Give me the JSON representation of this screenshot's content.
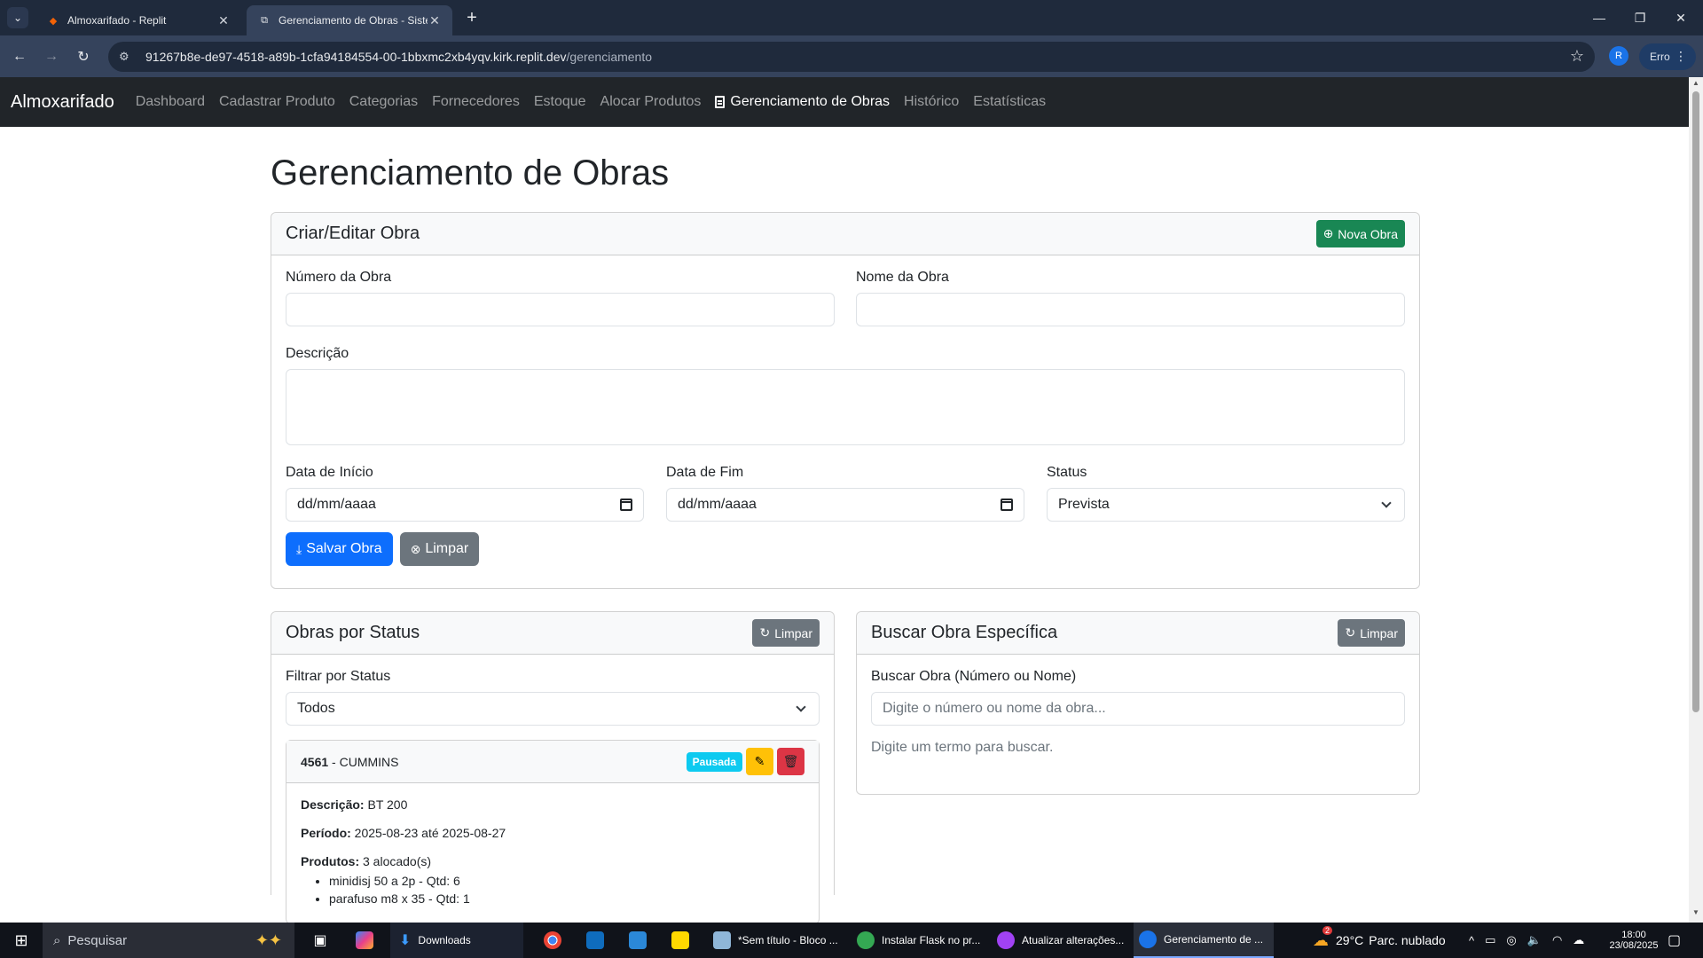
{
  "browser": {
    "tabs": [
      {
        "title": "Almoxarifado - Replit",
        "active": false
      },
      {
        "title": "Gerenciamento de Obras - Siste",
        "active": true
      }
    ],
    "url_host": "91267b8e-de97-4518-a89b-1cfa94184554-00-1bbxmc2xb4yqv.kirk.replit.dev",
    "url_path": "/gerenciamento",
    "profile_initial": "R",
    "error_label": "Erro"
  },
  "navbar": {
    "brand": "Almoxarifado",
    "links": [
      "Dashboard",
      "Cadastrar Produto",
      "Categorias",
      "Fornecedores",
      "Estoque",
      "Alocar Produtos",
      "Gerenciamento de Obras",
      "Histórico",
      "Estatísticas"
    ]
  },
  "page": {
    "title": "Gerenciamento de Obras"
  },
  "form_card": {
    "header": "Criar/Editar Obra",
    "new_button": "Nova Obra",
    "numero_label": "Número da Obra",
    "numero_value": "",
    "nome_label": "Nome da Obra",
    "nome_value": "",
    "descricao_label": "Descrição",
    "descricao_value": "",
    "data_inicio_label": "Data de Início",
    "data_inicio_value": "dd/mm/aaaa",
    "data_fim_label": "Data de Fim",
    "data_fim_value": "dd/mm/aaaa",
    "status_label": "Status",
    "status_value": "Prevista",
    "save_button": "Salvar Obra",
    "clear_button": "Limpar"
  },
  "status_card": {
    "header": "Obras por Status",
    "clear_button": "Limpar",
    "filter_label": "Filtrar por Status",
    "filter_value": "Todos",
    "obras": [
      {
        "numero": "4561",
        "separator": " - ",
        "nome": "CUMMINS",
        "status": "Pausada",
        "descricao_label": "Descrição:",
        "descricao": "BT 200",
        "periodo_label": "Período:",
        "periodo": "2025-08-23 até 2025-08-27",
        "produtos_label": "Produtos:",
        "produtos_count": "3 alocado(s)",
        "produtos": [
          "minidisj 50 a 2p - Qtd: 6",
          "parafuso m8 x 35 - Qtd: 1"
        ]
      }
    ]
  },
  "search_card": {
    "header": "Buscar Obra Específica",
    "clear_button": "Limpar",
    "search_label": "Buscar Obra (Número ou Nome)",
    "search_placeholder": "Digite o número ou nome da obra...",
    "hint": "Digite um termo para buscar."
  },
  "taskbar": {
    "search_placeholder": "Pesquisar",
    "items": [
      "Downloads",
      "*Sem título - Bloco ...",
      "Instalar Flask no pr...",
      "Atualizar alterações...",
      "Gerenciamento de ..."
    ],
    "weather": "29°C",
    "weather_desc": "Parc. nublado",
    "time": "18:00",
    "date": "23/08/2025",
    "notification_count": "2"
  },
  "colors": {
    "navbar_bg": "#212529",
    "success": "#198754",
    "primary": "#0d6efd",
    "secondary": "#6c757d",
    "warning": "#ffc107",
    "danger": "#dc3545",
    "info": "#0dcaf0"
  }
}
